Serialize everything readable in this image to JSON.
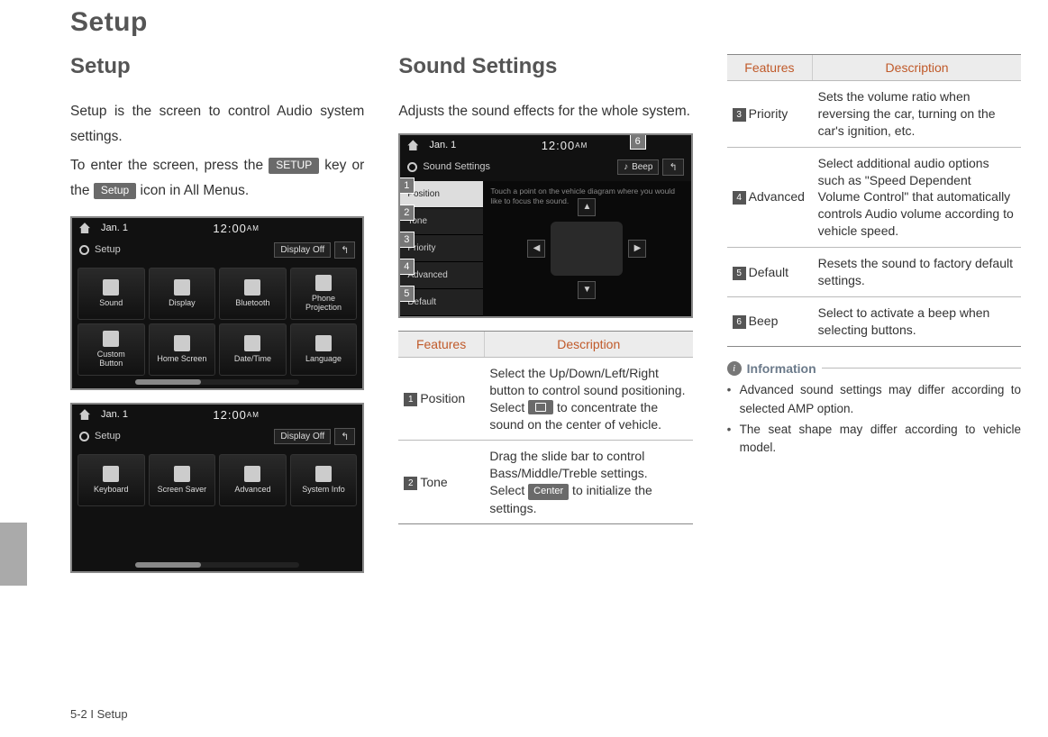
{
  "page": {
    "title": "Setup",
    "footer": "5-2 I Setup"
  },
  "col1": {
    "heading": "Setup",
    "para1": "Setup is the screen to control Audio system settings.",
    "para2a": "To enter the screen, press the ",
    "key_setup_hard": "SETUP",
    "para2b": " key or the ",
    "key_setup_soft": "Setup",
    "para2c": " icon in All Menus.",
    "shot_common": {
      "date": "Jan.  1",
      "time": "12:00",
      "ampm": "AM",
      "sub_label": "Setup",
      "display_off": "Display Off",
      "back_glyph": "↰"
    },
    "shot1_apps": [
      "Sound",
      "Display",
      "Bluetooth",
      "Phone\nProjection",
      "Custom\nButton",
      "Home Screen",
      "Date/Time",
      "Language"
    ],
    "shot2_apps": [
      "Keyboard",
      "Screen Saver",
      "Advanced",
      "System Info"
    ]
  },
  "col2": {
    "heading": "Sound Settings",
    "para": "Adjusts the sound effects for the whole system.",
    "shot": {
      "title": "Sound Settings",
      "beep": "Beep",
      "menu": [
        "Position",
        "Tone",
        "Priority",
        "Advanced",
        "Default"
      ],
      "hint": "Touch a point on the vehicle diagram where you would like to focus the sound."
    },
    "table_head_features": "Features",
    "table_head_desc": "Description",
    "row1": {
      "num": "1",
      "name": "Position",
      "desc_a": "Select the Up/Down/Left/Right button to control sound positioning.",
      "desc_b1": "Select ",
      "desc_b2": " to concentrate the sound on the center of vehicle."
    },
    "row2": {
      "num": "2",
      "name": "Tone",
      "desc_a": "Drag the slide bar to control Bass/Middle/Treble settings.",
      "desc_b1": "Select ",
      "center_chip": "Center",
      "desc_b2": " to initialize the settings."
    }
  },
  "col3": {
    "table_head_features": "Features",
    "table_head_desc": "Description",
    "rows": [
      {
        "num": "3",
        "name": "Priority",
        "desc": "Sets the volume ratio when reversing the car, turning on the car's ignition, etc."
      },
      {
        "num": "4",
        "name": "Advanced",
        "desc": "Select additional audio options such as \"Speed Dependent Volume Control\" that automatically controls Audio volume according to vehicle speed."
      },
      {
        "num": "5",
        "name": "Default",
        "desc": "Resets the sound to factory default settings."
      },
      {
        "num": "6",
        "name": "Beep",
        "desc": "Select to activate a beep when selecting buttons."
      }
    ],
    "info_title": "Information",
    "info_items": [
      "Advanced sound settings may differ according to selected AMP option.",
      "The seat shape may differ according to vehicle model."
    ]
  }
}
